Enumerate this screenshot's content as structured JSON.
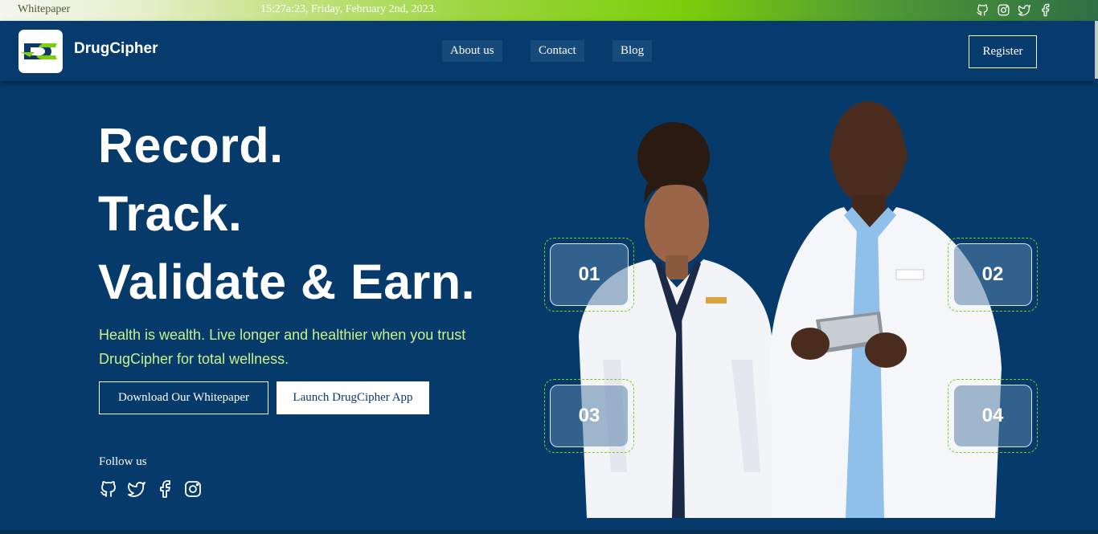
{
  "topbar": {
    "whitepaper_label": "Whitepaper",
    "datetime": "15:27a:23, Friday, February 2nd, 2023.",
    "social_icons": [
      "github-icon",
      "instagram-icon",
      "twitter-icon",
      "facebook-icon"
    ]
  },
  "nav": {
    "brand": "DrugCipher",
    "links": [
      "About us",
      "Contact",
      "Blog"
    ],
    "register": "Register"
  },
  "hero": {
    "lines": [
      "Record.",
      "Track.",
      "Validate & Earn."
    ],
    "tagline": "Health is wealth. Live longer and healthier when you trust DrugCipher for total wellness.",
    "download_button": "Download Our Whitepaper",
    "launch_button": "Launch DrugCipher App",
    "follow_label": "Follow us",
    "follow_icons": [
      "github-icon",
      "twitter-icon",
      "facebook-icon",
      "instagram-icon"
    ]
  },
  "features": [
    "01",
    "02",
    "03",
    "04"
  ],
  "colors": {
    "background": "#053a6b",
    "accent_green": "#7ccf0c",
    "tagline": "#c9f28b"
  }
}
